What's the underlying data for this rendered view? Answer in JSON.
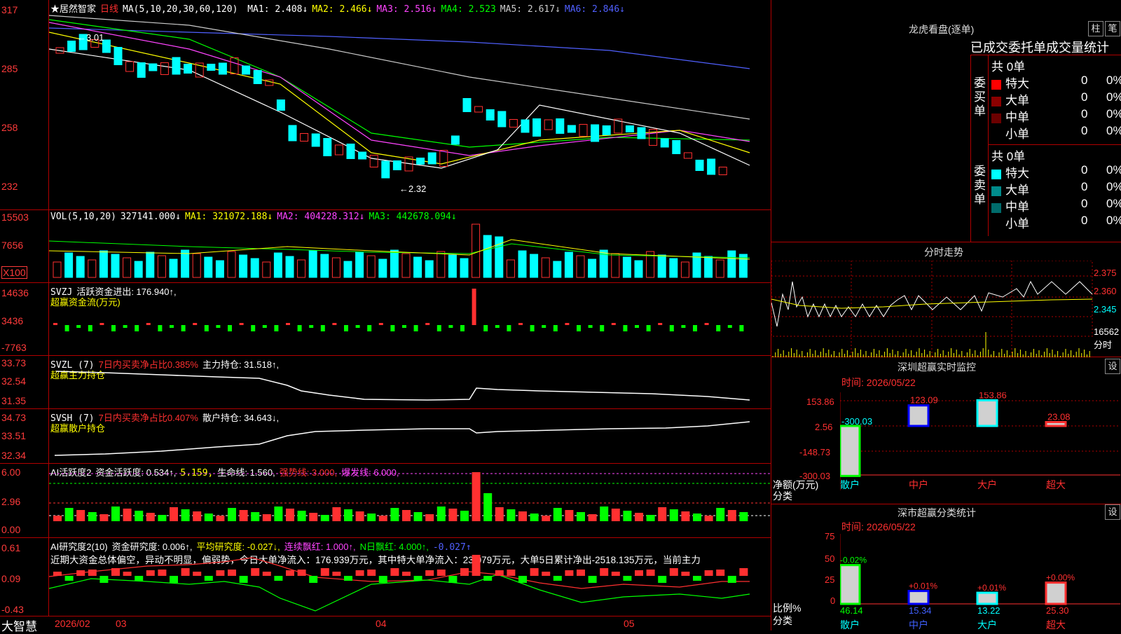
{
  "main": {
    "stock_name": "★居然智家",
    "period": "日线",
    "ma_header": "MA(5,10,20,30,60,120)",
    "ma": [
      {
        "label": "MA1:",
        "value": "2.408↓",
        "color": "#ffffff"
      },
      {
        "label": "MA2:",
        "value": "2.466↓",
        "color": "#ffff00"
      },
      {
        "label": "MA3:",
        "value": "2.516↓",
        "color": "#ff44ff"
      },
      {
        "label": "MA4:",
        "value": "2.523",
        "color": "#00ff00"
      },
      {
        "label": "MA5:",
        "value": "2.617↓",
        "color": "#cccccc"
      },
      {
        "label": "MA6:",
        "value": "2.846↓",
        "color": "#5060ff"
      }
    ],
    "y_ticks": [
      "317",
      "285",
      "258",
      "232"
    ],
    "high_label": "←3.01",
    "low_label": "←2.32"
  },
  "vol": {
    "header": "VOL(5,10,20)",
    "value": "327141.000↓",
    "ma1": "MA1: 321072.188↓",
    "ma2": "MA2: 404228.312↓",
    "ma3": "MA3: 442678.094↓",
    "y_ticks": [
      "15503",
      "7656",
      "X100"
    ]
  },
  "svzj": {
    "header": "SVZJ",
    "text": "活跃资金进出: 176.940↑,",
    "sub": "超赢资金流(万元)",
    "y_ticks": [
      "14636",
      "3436",
      "-7763"
    ]
  },
  "svzl": {
    "header": "SVZL (7)",
    "ratio": "7日内买卖净占比0.385%",
    "hold": "主力持仓: 31.518↑,",
    "sub": "超赢主力持仓",
    "y_ticks": [
      "33.73",
      "32.54",
      "31.35"
    ]
  },
  "svsh": {
    "header": "SVSH (7)",
    "ratio": "7日内买卖净占比0.407%",
    "hold": "散户持仓: 34.643↓,",
    "sub": "超赢散户持仓",
    "y_ticks": [
      "34.73",
      "33.51",
      "32.34"
    ]
  },
  "ai1": {
    "header": "AI活跃度2",
    "a": "资金活跃度: 0.534↑,",
    "b": "5.159,",
    "c": "生命线: 1.560,",
    "d": "强势线: 3.000,",
    "e": "爆发线: 6.000,",
    "y_ticks": [
      "6.00",
      "2.96",
      "0.00"
    ]
  },
  "ai2": {
    "header": "AI研究度2(10)",
    "a": "资金研究度: 0.006↑,",
    "b": "平均研究度: -0.027↓,",
    "c": "连续飘红: 1.000↑,",
    "d": "N日飘红: 4.000↑,",
    "e": "-0.027↑",
    "summary": "近期大资金总体偏空，异动不明显，偏弱势，今日大单净流入：176.939万元，其中特大单净流入：23.079万元，大单5日累计净出-2518.135万元，当前主力",
    "y_ticks": [
      "0.61",
      "0.09",
      "-0.43"
    ]
  },
  "xaxis": {
    "brand": "大智慧",
    "labels": [
      "2026/02",
      "03",
      "04",
      "05"
    ]
  },
  "longhu": {
    "title": "龙虎看盘(逐单)",
    "btn1": "柱",
    "btn2": "笔",
    "subtitle": "已成交委托单成交量统计",
    "buy_label": "委买单",
    "sell_label": "委卖单",
    "buy_total": "共 0单",
    "sell_total": "共 0单",
    "rows": [
      {
        "name": "特大",
        "n": "0",
        "p": "0%"
      },
      {
        "name": "大单",
        "n": "0",
        "p": "0%"
      },
      {
        "name": "中单",
        "n": "0",
        "p": "0%"
      },
      {
        "name": "小单",
        "n": "0",
        "p": "0%"
      }
    ]
  },
  "fenshi": {
    "title": "分时走势",
    "prices": [
      "2.375",
      "2.360",
      "2.345"
    ],
    "vol": "16562",
    "vol_unit": "分时"
  },
  "szmon": {
    "title": "深圳超赢实时监控",
    "btn": "设",
    "date": "时间: 2026/05/22",
    "y_ticks": [
      "153.86",
      "2.56",
      "-148.73",
      "-300.03"
    ],
    "unit": "净额(万元)",
    "cat_label": "分类",
    "categories": [
      "散户",
      "中户",
      "大户",
      "超大"
    ],
    "values": [
      -300.03,
      123.09,
      153.86,
      23.08
    ],
    "value_labels": [
      "-300.03",
      "123.09",
      "153.86",
      "23.08"
    ]
  },
  "szclass": {
    "title": "深市超赢分类统计",
    "btn": "设",
    "date": "时间: 2026/05/22",
    "y_ticks": [
      "75",
      "50",
      "25",
      "0"
    ],
    "unit": "比例%",
    "cat_label": "分类",
    "categories": [
      "散户",
      "中户",
      "大户",
      "超大"
    ],
    "values": [
      46.14,
      15.34,
      13.22,
      25.3
    ],
    "value_labels": [
      "46.14",
      "15.34",
      "13.22",
      "25.30"
    ],
    "change_labels": [
      "-0.02%",
      "+0.01%",
      "+0.01%",
      "+0.00%"
    ]
  }
}
